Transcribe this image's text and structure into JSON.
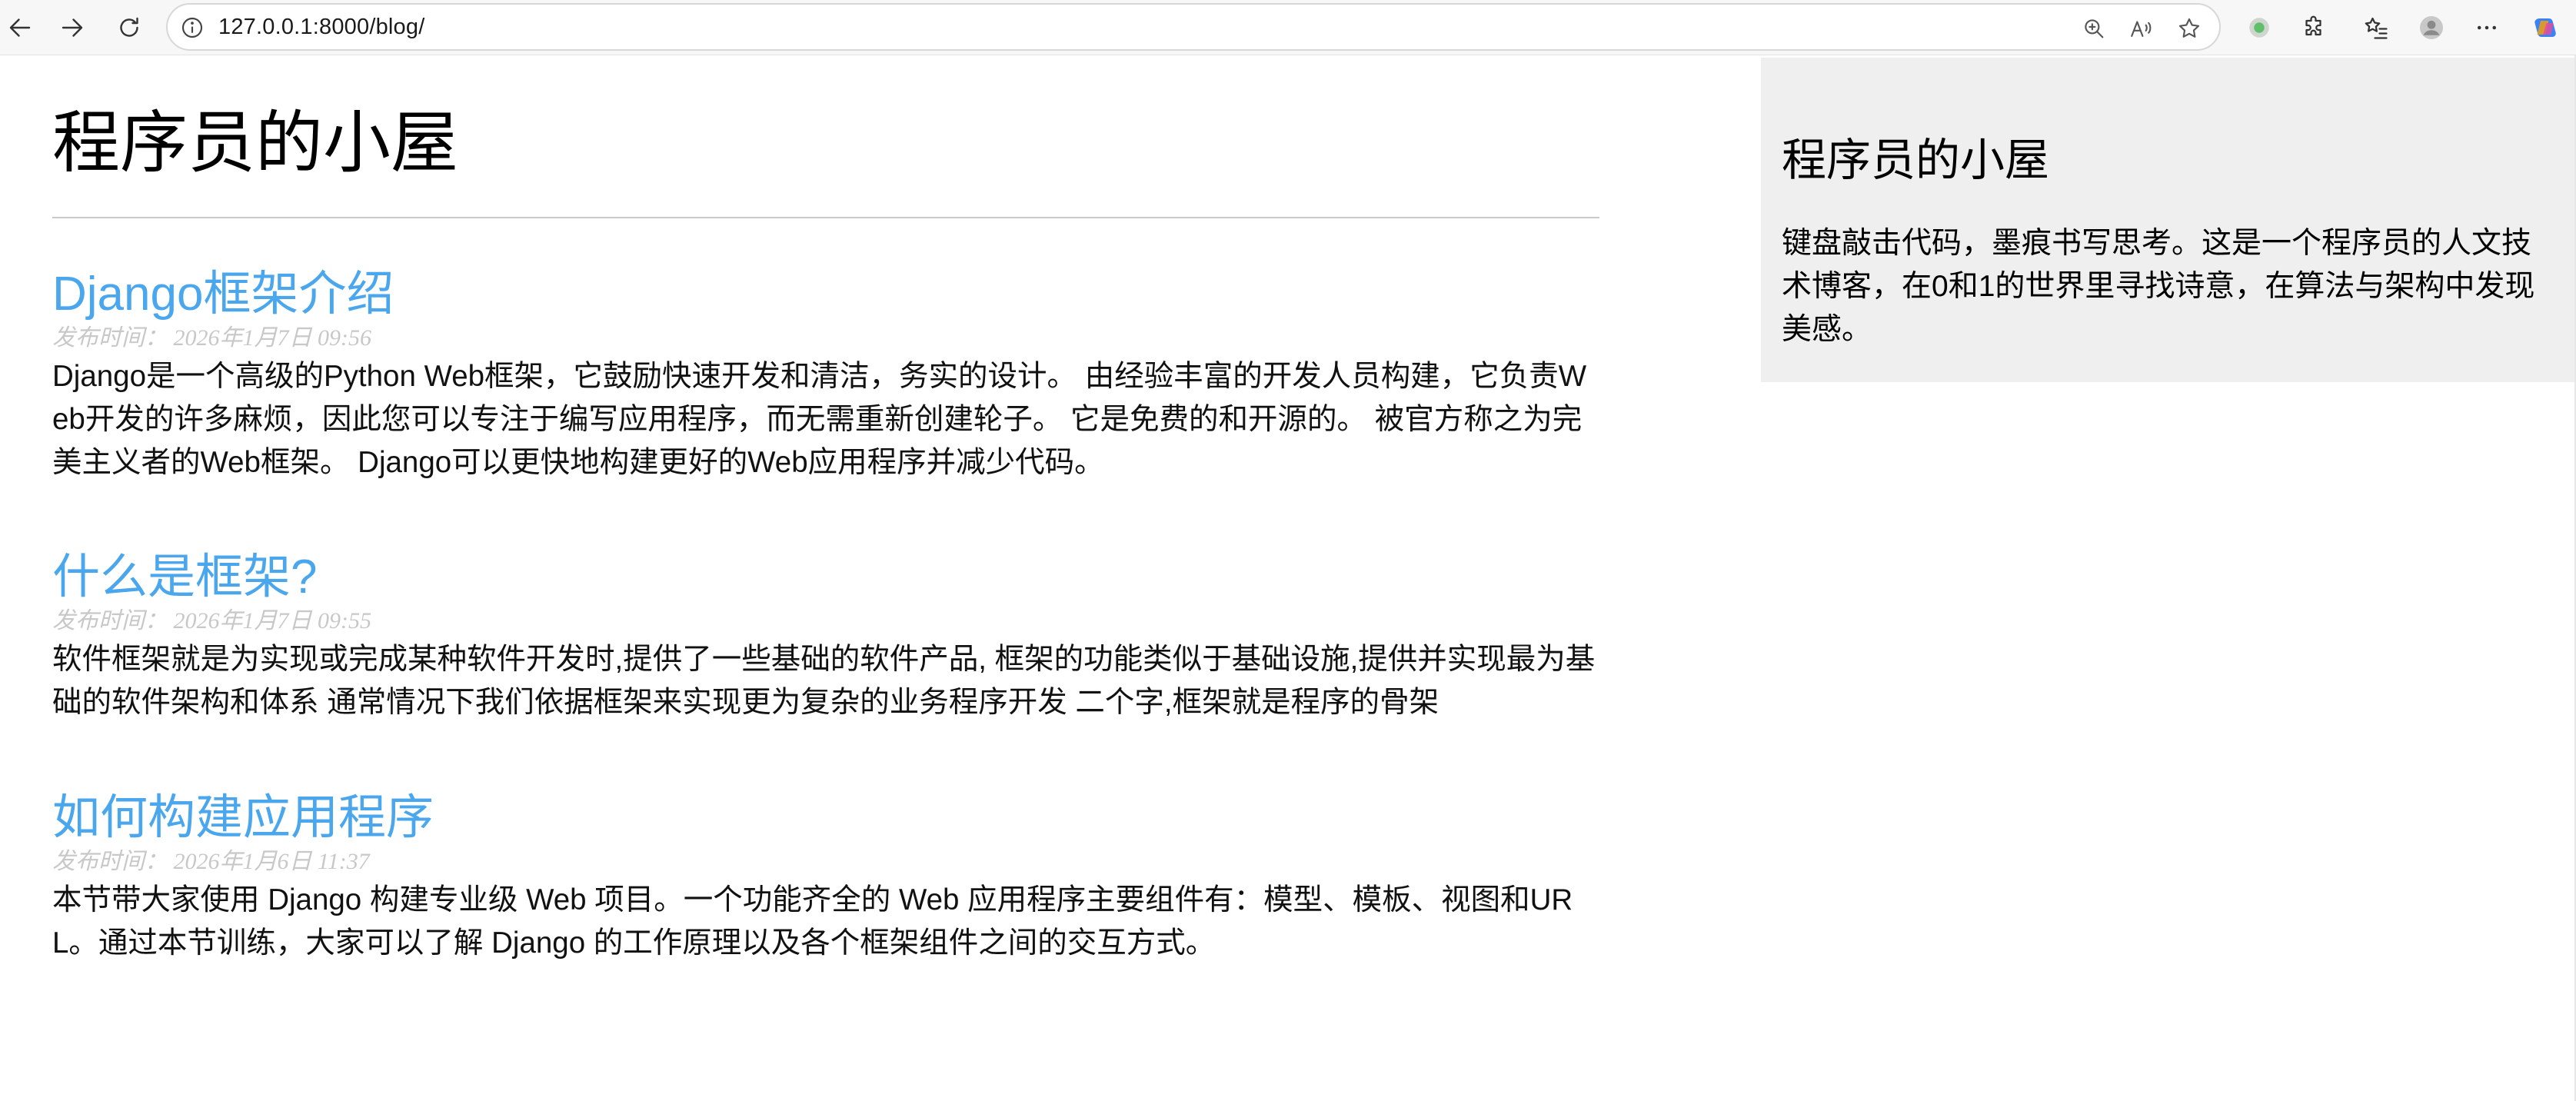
{
  "browser": {
    "url": "127.0.0.1:8000/blog/",
    "icons": [
      "back-icon",
      "forward-icon",
      "refresh-icon",
      "site-info-icon",
      "zoom-icon",
      "read-aloud-icon",
      "favorite-star-icon",
      "extension-green-dot-icon",
      "extensions-puzzle-icon",
      "favorites-list-icon",
      "profile-avatar-icon",
      "more-menu-icon",
      "copilot-icon"
    ]
  },
  "blog": {
    "site_title": "程序员的小屋",
    "posts": [
      {
        "title": "Django框架介绍",
        "meta": "发布时间： 2026年1月7日 09:56",
        "body": "Django是一个高级的Python Web框架，它鼓励快速开发和清洁，务实的设计。 由经验丰富的开发人员构建，它负责Web开发的许多麻烦，因此您可以专注于编写应用程序，而无需重新创建轮子。 它是免费的和开源的。 被官方称之为完美主义者的Web框架。 Django可以更快地构建更好的Web应用程序并减少代码。"
      },
      {
        "title": "什么是框架?",
        "meta": "发布时间： 2026年1月7日 09:55",
        "body": "软件框架就是为实现或完成某种软件开发时,提供了一些基础的软件产品, 框架的功能类似于基础设施,提供并实现最为基础的软件架构和体系 通常情况下我们依据框架来实现更为复杂的业务程序开发 二个字,框架就是程序的骨架"
      },
      {
        "title": "如何构建应用程序",
        "meta": "发布时间： 2026年1月6日 11:37",
        "body": "本节带大家使用 Django 构建专业级 Web 项目。一个功能齐全的 Web 应用程序主要组件有：模型、模板、视图和URL。通过本节训练，大家可以了解 Django 的工作原理以及各个框架组件之间的交互方式。"
      }
    ]
  },
  "sidebar": {
    "title": "程序员的小屋",
    "description": "键盘敲击代码，墨痕书写思考。这是一个程序员的人文技术博客，在0和1的世界里寻找诗意，在算法与架构中发现美感。"
  },
  "colors": {
    "link": "#4aa7ee",
    "meta": "#c8c8c8",
    "sidebar_bg": "#efefef"
  }
}
